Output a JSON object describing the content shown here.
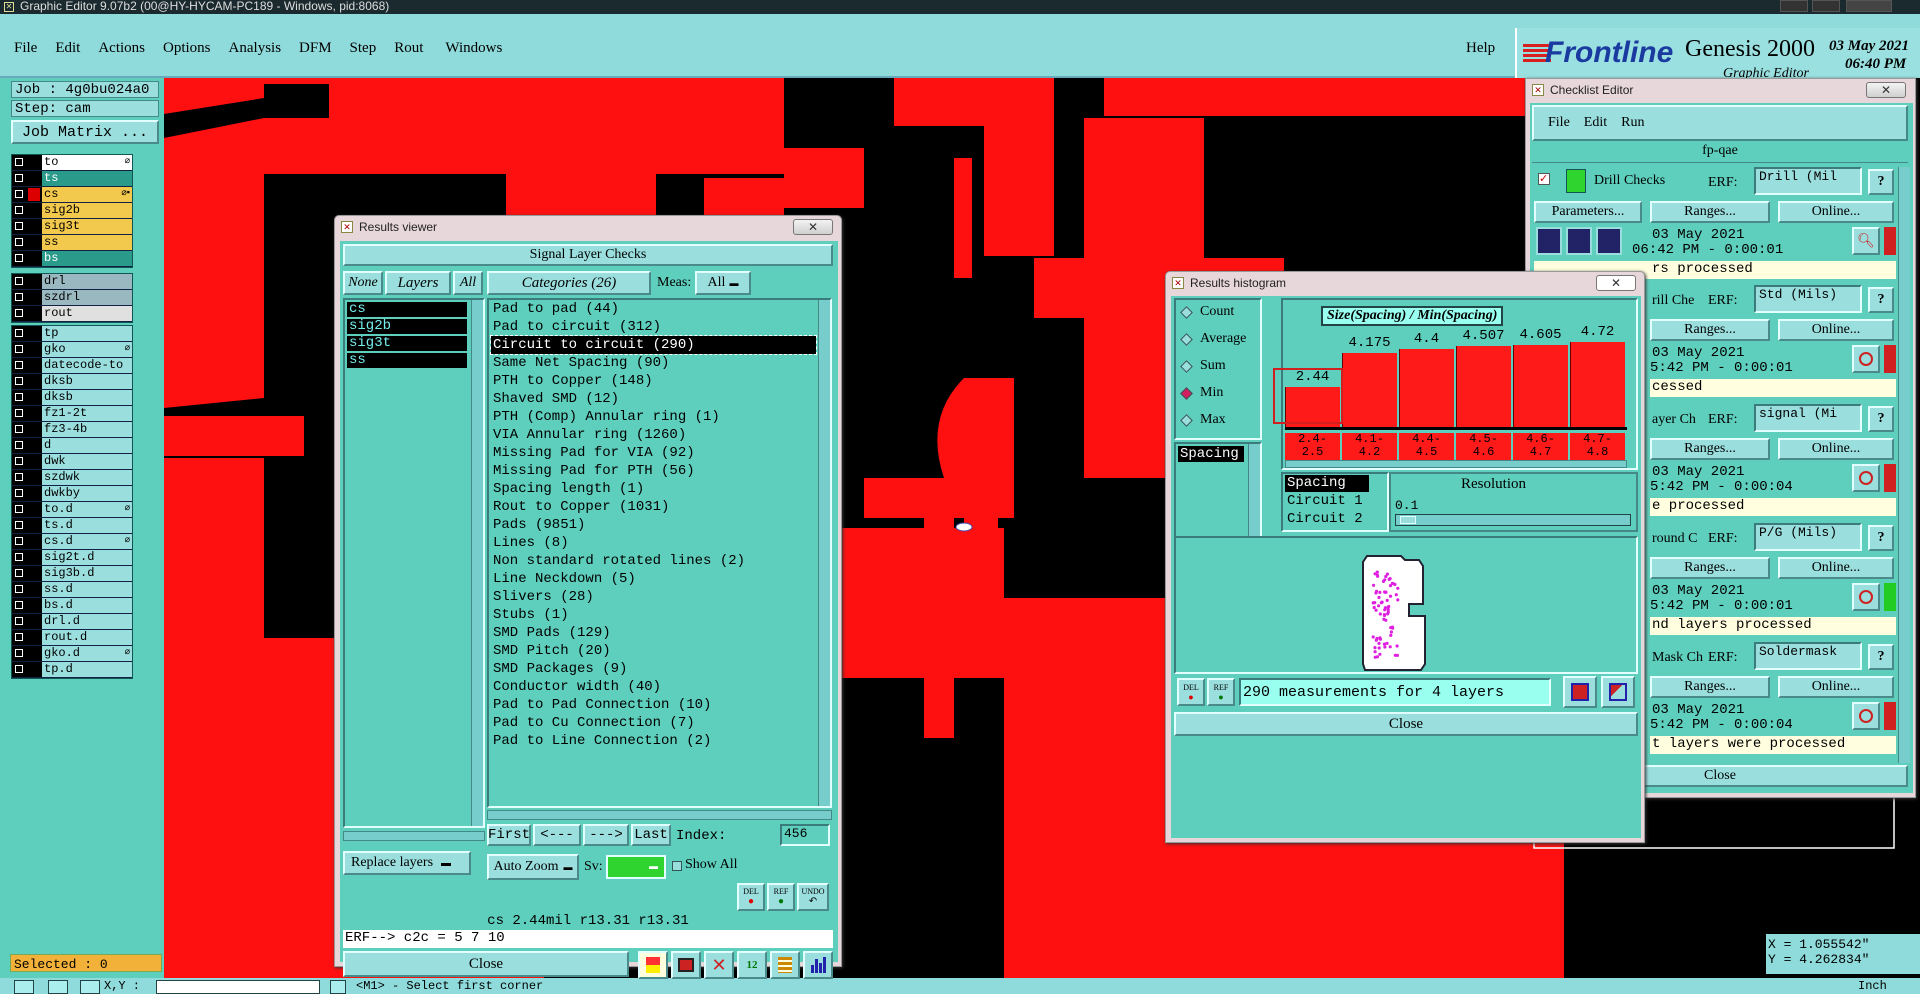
{
  "window": {
    "title": "Graphic Editor 9.07b2 (00@HY-HYCAM-PC189 - Windows, pid:8068)"
  },
  "menu": [
    "File",
    "Edit",
    "Actions",
    "Options",
    "Analysis",
    "DFM",
    "Step",
    "Rout",
    "Windows"
  ],
  "help": "Help",
  "brand": {
    "logo": "Frontline",
    "product": "Genesis 2000",
    "subtitle": "Graphic Editor",
    "date": "03 May 2021",
    "time": "06:40 PM"
  },
  "job": {
    "job": "Job : 4g0bu024a0",
    "step": "Step: cam",
    "matrix_button": "Job Matrix ..."
  },
  "layers": {
    "group1": [
      {
        "name": "to",
        "color": "#ffffff",
        "mark": "⌀"
      },
      {
        "name": "ts",
        "color": "#2a9a8a",
        "mark": ""
      },
      {
        "name": "cs",
        "color": "#f2c94c",
        "mark": "⌀▪"
      },
      {
        "name": "sig2b",
        "color": "#f2c94c",
        "mark": ""
      },
      {
        "name": "sig3t",
        "color": "#f2c94c",
        "mark": ""
      },
      {
        "name": "ss",
        "color": "#f2c94c",
        "mark": ""
      },
      {
        "name": "bs",
        "color": "#2a9a8a",
        "mark": ""
      }
    ],
    "group2": [
      {
        "name": "drl",
        "color": "#9ab8c0",
        "mark": ""
      },
      {
        "name": "szdrl",
        "color": "#9ab8c0",
        "mark": ""
      },
      {
        "name": "rout",
        "color": "#e0e0e0",
        "mark": ""
      }
    ],
    "group3": [
      {
        "name": "tp",
        "mark": ""
      },
      {
        "name": "gko",
        "mark": "⌀"
      },
      {
        "name": "datecode-to",
        "mark": ""
      },
      {
        "name": "dksb",
        "mark": ""
      },
      {
        "name": "dksb",
        "mark": ""
      },
      {
        "name": "fz1-2t",
        "mark": ""
      },
      {
        "name": "fz3-4b",
        "mark": ""
      },
      {
        "name": "d",
        "mark": ""
      },
      {
        "name": "dwk",
        "mark": ""
      },
      {
        "name": "szdwk",
        "mark": ""
      },
      {
        "name": "dwkby",
        "mark": ""
      },
      {
        "name": "to.d",
        "mark": "⌀"
      },
      {
        "name": "ts.d",
        "mark": ""
      },
      {
        "name": "cs.d",
        "mark": "⌀"
      },
      {
        "name": "sig2t.d",
        "mark": ""
      },
      {
        "name": "sig3b.d",
        "mark": ""
      },
      {
        "name": "ss.d",
        "mark": ""
      },
      {
        "name": "bs.d",
        "mark": ""
      },
      {
        "name": "drl.d",
        "mark": ""
      },
      {
        "name": "rout.d",
        "mark": ""
      },
      {
        "name": "gko.d",
        "mark": "⌀"
      },
      {
        "name": "tp.d",
        "mark": ""
      }
    ]
  },
  "selected": "Selected : 0",
  "statusbar": {
    "left_label": "X,Y :",
    "prompt": "<M1> - Select first corner",
    "units": "Inch",
    "coords": {
      "x": "X = 1.055542\"",
      "y": "Y = 4.262834\""
    }
  },
  "results_viewer": {
    "title": "Results viewer",
    "section": "Signal Layer Checks",
    "tabs": {
      "none": "None",
      "layers": "Layers",
      "all": "All"
    },
    "layer_list": [
      "cs",
      "sig2b",
      "sig3t",
      "ss"
    ],
    "categories_label": "Categories (26)",
    "meas_label": "Meas:",
    "meas_value": "All",
    "categories": [
      "Pad to pad (44)",
      "Pad to circuit (312)",
      "Circuit to circuit (290)",
      "Same Net Spacing (90)",
      "PTH to Copper (148)",
      "Shaved SMD (12)",
      "PTH (Comp) Annular ring (1)",
      "VIA Annular ring (1260)",
      "Missing Pad for VIA (92)",
      "Missing Pad for PTH (56)",
      "Spacing length (1)",
      "Rout to Copper (1031)",
      "Pads (9851)",
      "Lines (8)",
      "Non standard rotated lines (2)",
      "Line Neckdown (5)",
      "Slivers (28)",
      "Stubs (1)",
      "SMD Pads (129)",
      "SMD Pitch (20)",
      "SMD Packages (9)",
      "Conductor width (40)",
      "Pad to Pad Connection (10)",
      "Pad to Cu Connection (7)",
      "Pad to Line Connection (2)"
    ],
    "selected_index": 2,
    "nav": {
      "first": "First",
      "prev": "<---",
      "next": "--->",
      "last": "Last",
      "index_label": "Index:",
      "index_value": "456"
    },
    "autozoom": "Auto Zoom",
    "sv_label": "Sv:",
    "show_all": "Show All",
    "replace_layers": "Replace layers",
    "mini": {
      "del": "DEL",
      "ref": "REF",
      "undo": "UNDO"
    },
    "info": "cs 2.44mil  r13.31  r13.31",
    "erf": "ERF--> c2c = 5 7 10",
    "close": "Close"
  },
  "histogram": {
    "title": "Results histogram",
    "options": [
      "Count",
      "Average",
      "Sum",
      "Min",
      "Max"
    ],
    "selected_option": "Min",
    "list": [
      "Spacing"
    ],
    "chart_title": "Size(Spacing) / Min(Spacing)",
    "bars": [
      {
        "value": "2.44",
        "range": "2.4-\n2.5",
        "level": 0.31
      },
      {
        "value": "4.175",
        "range": "4.1-\n4.2",
        "level": 0.57
      },
      {
        "value": "4.4",
        "range": "4.4-\n4.5",
        "level": 0.6
      },
      {
        "value": "4.507",
        "range": "4.5-\n4.6",
        "level": 0.62
      },
      {
        "value": "4.605",
        "range": "4.6-\n4.7",
        "level": 0.63
      },
      {
        "value": "4.72",
        "range": "4.7-\n4.8",
        "level": 0.65
      }
    ],
    "series_list": [
      "Spacing",
      "Circuit 1",
      "Circuit 2"
    ],
    "resolution_label": "Resolution",
    "resolution_value": "0.1",
    "del": "DEL",
    "ref": "REF",
    "summary": "290 measurements for 4 layers",
    "close": "Close",
    "colors": {
      "bar": "#ff1a1a",
      "points": "#e020e0"
    }
  },
  "checklist": {
    "title": "Checklist Editor",
    "menu": [
      "File",
      "Edit",
      "Run"
    ],
    "name": "fp-qae",
    "first": {
      "title": "Drill Checks",
      "erf": "ERF:",
      "erf_value": "Drill (Mil",
      "params": "Parameters...",
      "ranges": "Ranges...",
      "online": "Online...",
      "date": "03 May 2021",
      "time": "06:42 PM - 0:00:01",
      "status": "rs processed"
    },
    "rows": [
      {
        "title": "rill Che",
        "erf_value": "Std (Mils)",
        "ranges": "Ranges...",
        "online": "Online...",
        "date": "03 May 2021",
        "time": "5:42 PM - 0:00:01",
        "status": "cessed",
        "flag": "#d02020"
      },
      {
        "title": "ayer Ch",
        "erf_value": "signal (Mi",
        "ranges": "Ranges...",
        "online": "Online...",
        "date": "03 May 2021",
        "time": "5:42 PM - 0:00:04",
        "status": "e processed",
        "flag": "#d02020"
      },
      {
        "title": "round C",
        "erf_value": "P/G (Mils)",
        "ranges": "Ranges...",
        "online": "Online...",
        "date": "03 May 2021",
        "time": "5:42 PM - 0:00:01",
        "status": "nd layers processed",
        "flag": "#22cc22"
      },
      {
        "title": "Mask Ch",
        "erf_value": "Soldermask",
        "ranges": "Ranges...",
        "online": "Online...",
        "date": "03 May 2021",
        "time": "5:42 PM - 0:00:04",
        "status": "t layers were processed",
        "flag": "#d02020"
      }
    ],
    "erf": "ERF:",
    "close": "Close"
  }
}
